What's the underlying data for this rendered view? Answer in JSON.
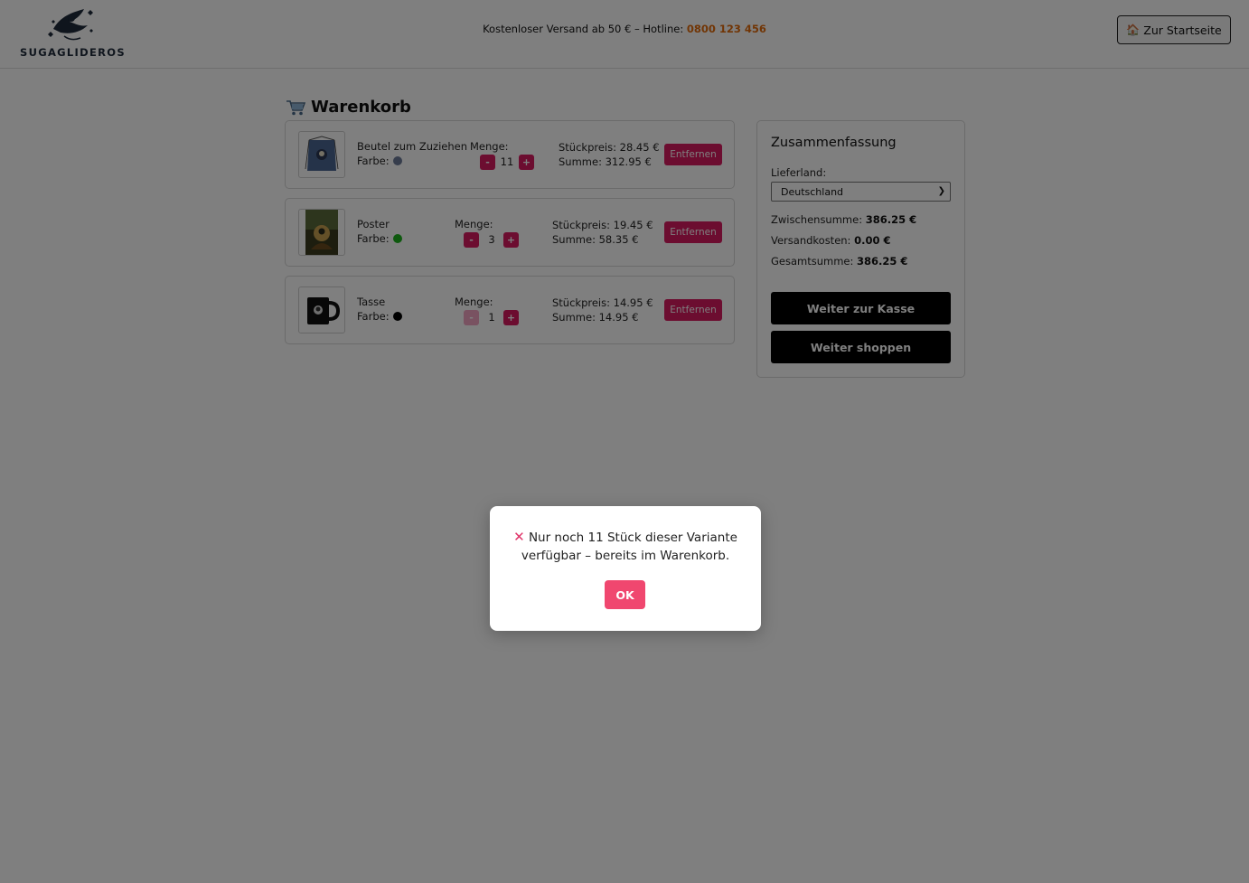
{
  "header": {
    "logo_text": "SUGAGLIDEROS",
    "shipping_text": "Kostenloser Versand ab 50 € – Hotline: ",
    "hotline": "0800 123 456",
    "home_button": "Zur Startseite",
    "home_icon": "house-icon"
  },
  "cart": {
    "title": "Warenkorb",
    "title_icon": "shopping-cart-icon",
    "items": [
      {
        "name": "Beutel zum Zuziehen",
        "color_label": "Farbe:",
        "color": "#6c7a99",
        "qty_label": "Menge:",
        "qty": "11",
        "minus": "-",
        "plus": "+",
        "unit_price": "Stückpreis: 28.45 €",
        "total": "Summe: 312.95 €",
        "remove": "Entfernen"
      },
      {
        "name": "Poster",
        "color_label": "Farbe:",
        "color": "#1db31d",
        "qty_label": "Menge:",
        "qty": "3",
        "minus": "-",
        "plus": "+",
        "unit_price": "Stückpreis: 19.45 €",
        "total": "Summe: 58.35 €",
        "remove": "Entfernen"
      },
      {
        "name": "Tasse",
        "color_label": "Farbe:",
        "color": "#000000",
        "qty_label": "Menge:",
        "qty": "1",
        "minus": "-",
        "plus": "+",
        "unit_price": "Stückpreis: 14.95 €",
        "total": "Summe: 14.95 €",
        "remove": "Entfernen"
      }
    ]
  },
  "summary": {
    "title": "Zusammenfassung",
    "country_label": "Lieferland:",
    "country_selected": "Deutschland",
    "subtotal_label": "Zwischensumme: ",
    "subtotal": "386.25 €",
    "shipping_label": "Versandkosten: ",
    "shipping": "0.00 €",
    "total_label": "Gesamtsumme: ",
    "total": "386.25 €",
    "checkout_button": "Weiter zur Kasse",
    "continue_button": "Weiter shoppen"
  },
  "modal": {
    "icon": "x-icon",
    "message": "Nur noch 11 Stück dieser Variante verfügbar – bereits im Warenkorb.",
    "ok_button": "OK"
  },
  "colors": {
    "accent": "#d81b60",
    "ok_button": "#f0476f",
    "hotline": "#e36a0a"
  }
}
